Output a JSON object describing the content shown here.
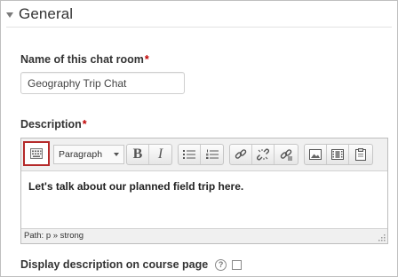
{
  "section": {
    "title": "General"
  },
  "name_field": {
    "label": "Name of this chat room",
    "required_mark": "*",
    "value": "Geography Trip Chat"
  },
  "description": {
    "label": "Description",
    "required_mark": "*",
    "toolbar": {
      "format_select": "Paragraph",
      "buttons": [
        "kitchen-sink-icon",
        "bold-icon",
        "italic-icon",
        "unordered-list-icon",
        "ordered-list-icon",
        "link-icon",
        "unlink-icon",
        "anchor-icon",
        "image-icon",
        "media-icon",
        "paste-icon"
      ]
    },
    "content": "Let's talk about our planned field trip here.",
    "path": "Path: p » strong"
  },
  "display_option": {
    "label": "Display description on course page",
    "help_icon": "?",
    "checked": false
  },
  "colors": {
    "required": "#c00000",
    "highlight": "#b52a2a"
  }
}
